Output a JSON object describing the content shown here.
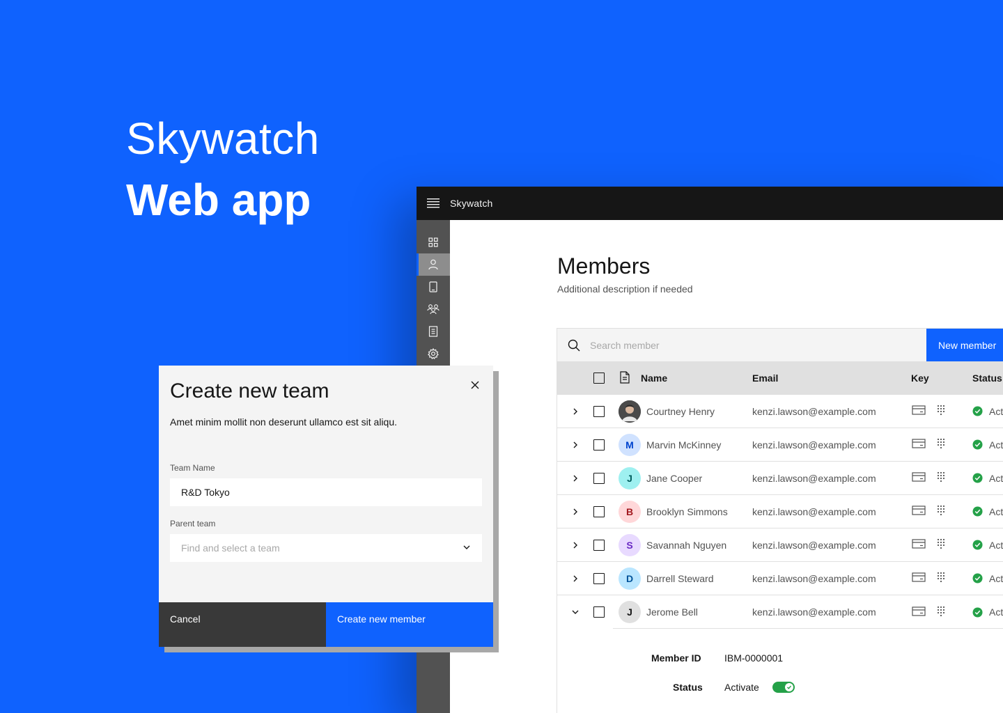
{
  "hero": {
    "line1": "Skywatch",
    "line2": "Web app"
  },
  "header": {
    "app_name": "Skywatch"
  },
  "page": {
    "title": "Members",
    "description": "Additional description if needed"
  },
  "search": {
    "placeholder": "Search member"
  },
  "toolbar": {
    "new_member_label": "New member"
  },
  "table": {
    "columns": {
      "name": "Name",
      "email": "Email",
      "key": "Key",
      "status": "Status"
    },
    "rows": [
      {
        "initial": "",
        "name": "Courtney Henry",
        "email": "kenzi.lawson@example.com",
        "status": "Act",
        "avatar_bg": "#3d3d3d",
        "avatar_fg": "#ffffff",
        "expanded": false,
        "photo": true
      },
      {
        "initial": "M",
        "name": "Marvin McKinney",
        "email": "kenzi.lawson@example.com",
        "status": "Act",
        "avatar_bg": "#d0e2ff",
        "avatar_fg": "#0043ce",
        "expanded": false
      },
      {
        "initial": "J",
        "name": "Jane Cooper",
        "email": "kenzi.lawson@example.com",
        "status": "Act",
        "avatar_bg": "#9ef0f0",
        "avatar_fg": "#005d5d",
        "expanded": false
      },
      {
        "initial": "B",
        "name": "Brooklyn Simmons",
        "email": "kenzi.lawson@example.com",
        "status": "Act",
        "avatar_bg": "#ffd7d9",
        "avatar_fg": "#a2191f",
        "expanded": false
      },
      {
        "initial": "S",
        "name": "Savannah Nguyen",
        "email": "kenzi.lawson@example.com",
        "status": "Act",
        "avatar_bg": "#e8daff",
        "avatar_fg": "#6929c4",
        "expanded": false
      },
      {
        "initial": "D",
        "name": "Darrell Steward",
        "email": "kenzi.lawson@example.com",
        "status": "Act",
        "avatar_bg": "#bae6ff",
        "avatar_fg": "#00539a",
        "expanded": false
      },
      {
        "initial": "J",
        "name": "Jerome Bell",
        "email": "kenzi.lawson@example.com",
        "status": "Act",
        "avatar_bg": "#e0e0e0",
        "avatar_fg": "#161616",
        "expanded": true
      }
    ]
  },
  "detail": {
    "member_id_label": "Member ID",
    "member_id": "IBM-0000001",
    "status_label": "Status",
    "status_value": "Activate",
    "toggle_on": true
  },
  "modal": {
    "title": "Create new team",
    "description": "Amet minim mollit non deserunt ullamco est sit aliqu.",
    "team_name_label": "Team Name",
    "team_name_value": "R&D Tokyo",
    "parent_team_label": "Parent team",
    "parent_team_placeholder": "Find and select a team",
    "cancel_label": "Cancel",
    "create_label": "Create new member"
  },
  "colors": {
    "brand": "#0f62fe",
    "success": "#24a148",
    "header_bg": "#161616",
    "rail_bg": "#525252"
  },
  "rail_icons": [
    "dashboard-icon",
    "user-icon",
    "device-icon",
    "group-icon",
    "report-icon",
    "settings-icon"
  ]
}
